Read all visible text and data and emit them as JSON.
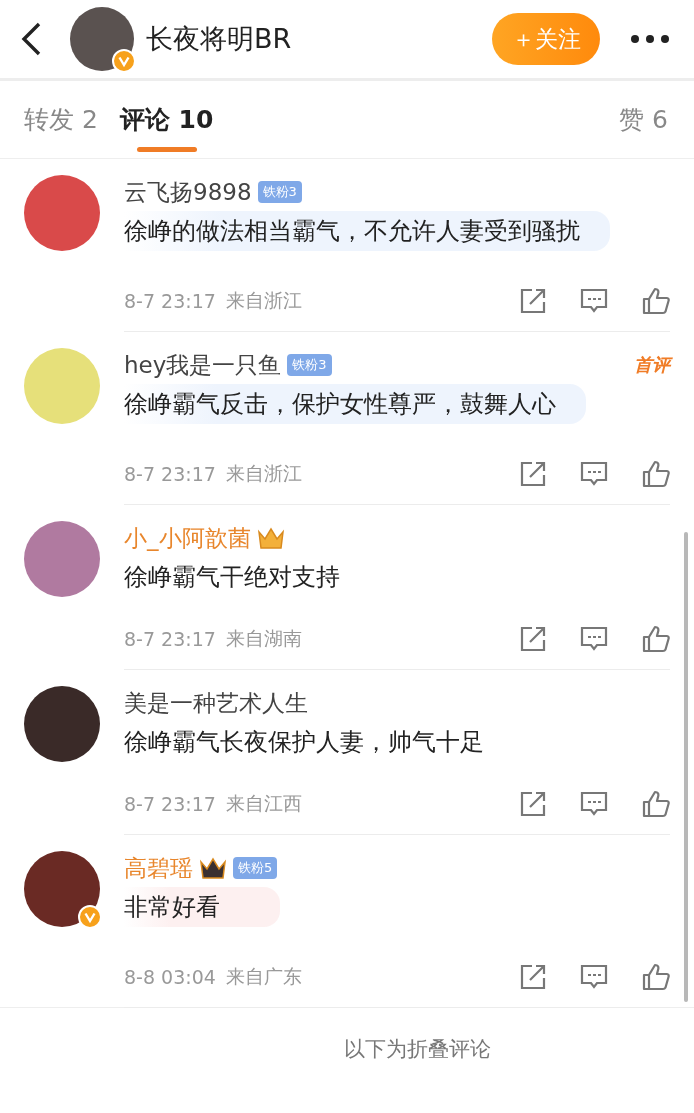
{
  "header": {
    "title": "长夜将明BR",
    "follow_button": "＋关注",
    "verified": true
  },
  "tabs": [
    {
      "label": "转发 2",
      "selected": false
    },
    {
      "label": "评论 10",
      "selected": true
    },
    {
      "label": "赞 6",
      "selected": false
    }
  ],
  "comments": [
    {
      "kind": "highlighted",
      "name": "云飞扬9898",
      "vip": false,
      "crown": false,
      "verified": false,
      "fan_badge": "铁粉3",
      "text": "徐峥的做法相当霸气，不允许人妻受到骚扰",
      "time": "8-7 23:17",
      "location": "来自浙江"
    },
    {
      "kind": "highlighted",
      "name": "hey我是一只鱼",
      "vip": false,
      "crown": false,
      "verified": false,
      "fan_badge": "铁粉3",
      "first_tag": "首评",
      "text": "徐峥霸气反击，保护女性尊严，鼓舞人心",
      "time": "8-7 23:17",
      "location": "来自浙江"
    },
    {
      "kind": "plain",
      "name": "小_小阿歆菌",
      "vip": true,
      "crown": true,
      "verified": false,
      "text": "徐峥霸气干绝对支持",
      "time": "8-7 23:17",
      "location": "来自湖南"
    },
    {
      "kind": "plain",
      "name": "美是一种艺术人生",
      "vip": false,
      "crown": false,
      "verified": false,
      "text": "徐峥霸气长夜保护人妻，帅气十足",
      "time": "8-7 23:17",
      "location": "来自江西"
    },
    {
      "kind": "sticker",
      "name": "高碧瑶",
      "vip": true,
      "crown": true,
      "verified": true,
      "fan_badge": "铁粉5",
      "text": "非常好看",
      "time": "8-8 03:04",
      "location": "来自广东"
    }
  ],
  "folded_notice": "以下为折叠评论"
}
